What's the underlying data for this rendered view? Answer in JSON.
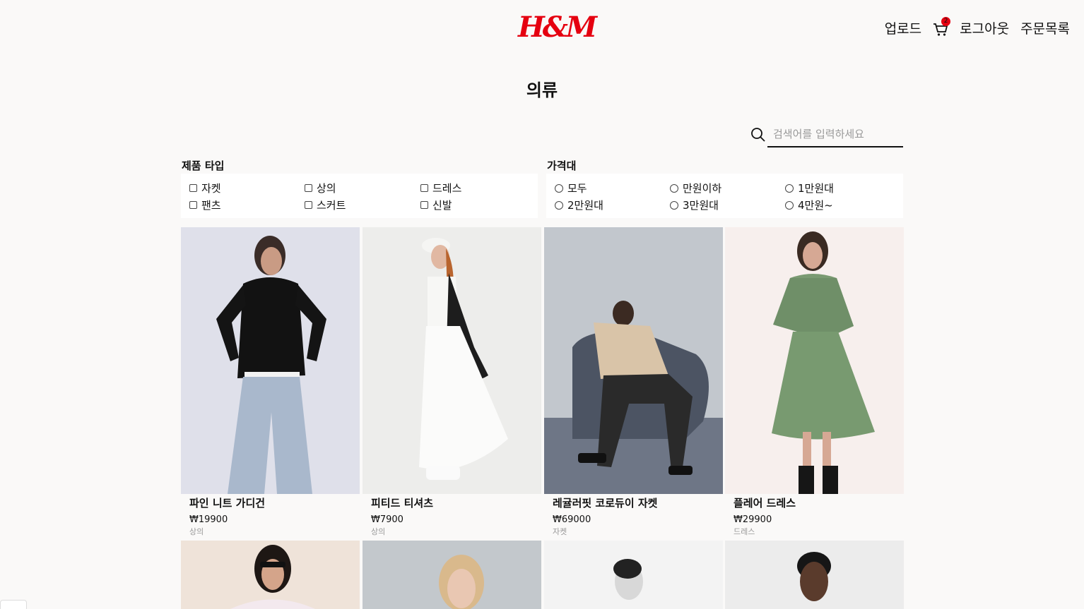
{
  "header": {
    "logo": "H&M",
    "nav": {
      "upload": "업로드",
      "cart_count": "2",
      "logout": "로그아웃",
      "orders": "주문목록"
    }
  },
  "page_title": "의류",
  "search": {
    "placeholder": "검색어를 입력하세요"
  },
  "filters": {
    "type": {
      "label": "제품 타입",
      "options": [
        "자켓",
        "상의",
        "드레스",
        "팬츠",
        "스커트",
        "신발"
      ]
    },
    "price": {
      "label": "가격대",
      "options": [
        "모두",
        "만원이하",
        "1만원대",
        "2만원대",
        "3만원대",
        "4만원~"
      ]
    }
  },
  "products": [
    {
      "name": "파인 니트 가디건",
      "price": "₩19900",
      "category": "상의"
    },
    {
      "name": "피티드 티셔츠",
      "price": "₩7900",
      "category": "상의"
    },
    {
      "name": "레귤러핏 코로듀이 자켓",
      "price": "₩69000",
      "category": "자켓"
    },
    {
      "name": "플레어 드레스",
      "price": "₩29900",
      "category": "드레스"
    }
  ],
  "colors": {
    "brand": "#e50010",
    "background": "#faf9f8"
  }
}
